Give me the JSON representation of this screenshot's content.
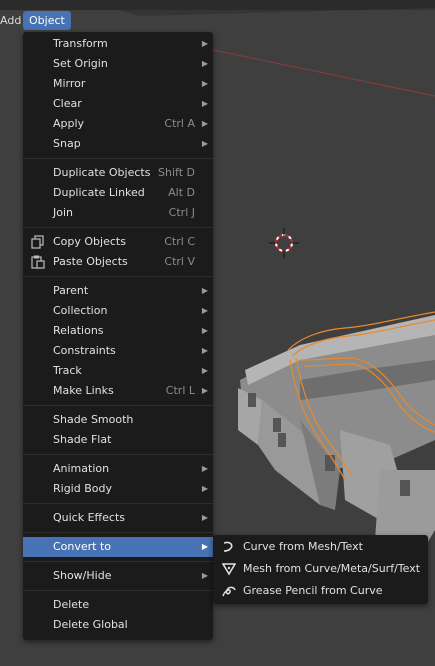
{
  "header": {
    "add_label": "Add",
    "object_label": "Object"
  },
  "menu": {
    "items": [
      {
        "label": "Transform"
      },
      {
        "label": "Set Origin"
      },
      {
        "label": "Mirror"
      },
      {
        "label": "Clear"
      },
      {
        "label": "Apply",
        "shortcut": "Ctrl A"
      },
      {
        "label": "Snap"
      },
      {
        "label": "Duplicate Objects",
        "shortcut": "Shift D"
      },
      {
        "label": "Duplicate Linked",
        "shortcut": "Alt D"
      },
      {
        "label": "Join",
        "shortcut": "Ctrl J"
      },
      {
        "label": "Copy Objects",
        "shortcut": "Ctrl C"
      },
      {
        "label": "Paste Objects",
        "shortcut": "Ctrl V"
      },
      {
        "label": "Parent"
      },
      {
        "label": "Collection"
      },
      {
        "label": "Relations"
      },
      {
        "label": "Constraints"
      },
      {
        "label": "Track"
      },
      {
        "label": "Make Links",
        "shortcut": "Ctrl L"
      },
      {
        "label": "Shade Smooth"
      },
      {
        "label": "Shade Flat"
      },
      {
        "label": "Animation"
      },
      {
        "label": "Rigid Body"
      },
      {
        "label": "Quick Effects"
      },
      {
        "label": "Convert to"
      },
      {
        "label": "Show/Hide"
      },
      {
        "label": "Delete"
      },
      {
        "label": "Delete Global"
      }
    ]
  },
  "submenu": {
    "items": [
      {
        "label": "Curve from Mesh/Text"
      },
      {
        "label": "Mesh from Curve/Meta/Surf/Text"
      },
      {
        "label": "Grease Pencil from Curve"
      }
    ]
  },
  "colors": {
    "menu_bg": "#1b1b1b",
    "active_highlight": "#4772b3",
    "viewport_bg": "#3f3f3f",
    "selection_outline": "#e8892b"
  },
  "icons": [
    "submenu-arrow-icon",
    "copy-icon",
    "paste-icon",
    "curve-icon",
    "mesh-triangle-icon",
    "grease-pencil-icon",
    "3d-cursor-icon"
  ]
}
